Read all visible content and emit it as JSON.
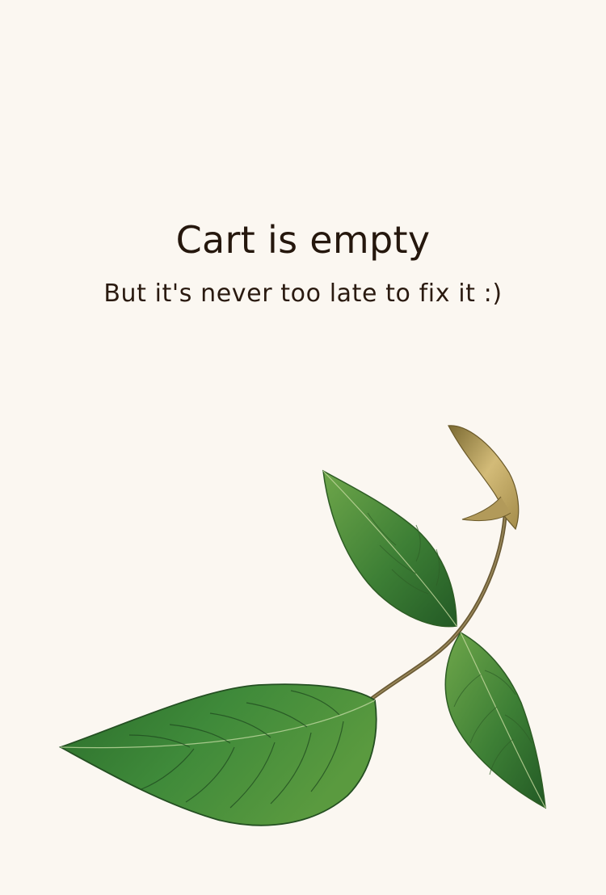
{
  "empty_state": {
    "title": "Cart is empty",
    "subtitle": "But it's never too late to fix it :)",
    "illustration": "mint-leaf-sprig-icon"
  },
  "colors": {
    "background": "#fbf7f1",
    "text": "#25170d",
    "leaf_dark": "#2f6b2a",
    "leaf_light": "#5f9a3e",
    "bud": "#c8ad6b"
  }
}
